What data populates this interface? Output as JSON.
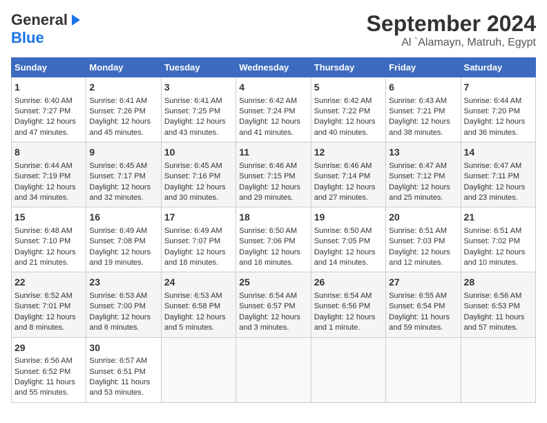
{
  "header": {
    "logo_line1": "General",
    "logo_line2": "Blue",
    "title": "September 2024",
    "subtitle": "Al `Alamayn, Matruh, Egypt"
  },
  "calendar": {
    "days_of_week": [
      "Sunday",
      "Monday",
      "Tuesday",
      "Wednesday",
      "Thursday",
      "Friday",
      "Saturday"
    ],
    "weeks": [
      [
        {
          "day": "",
          "content": ""
        },
        {
          "day": "2",
          "content": "Sunrise: 6:41 AM\nSunset: 7:26 PM\nDaylight: 12 hours\nand 45 minutes."
        },
        {
          "day": "3",
          "content": "Sunrise: 6:41 AM\nSunset: 7:25 PM\nDaylight: 12 hours\nand 43 minutes."
        },
        {
          "day": "4",
          "content": "Sunrise: 6:42 AM\nSunset: 7:24 PM\nDaylight: 12 hours\nand 41 minutes."
        },
        {
          "day": "5",
          "content": "Sunrise: 6:42 AM\nSunset: 7:22 PM\nDaylight: 12 hours\nand 40 minutes."
        },
        {
          "day": "6",
          "content": "Sunrise: 6:43 AM\nSunset: 7:21 PM\nDaylight: 12 hours\nand 38 minutes."
        },
        {
          "day": "7",
          "content": "Sunrise: 6:44 AM\nSunset: 7:20 PM\nDaylight: 12 hours\nand 36 minutes."
        }
      ],
      [
        {
          "day": "1",
          "content": "Sunrise: 6:40 AM\nSunset: 7:27 PM\nDaylight: 12 hours\nand 47 minutes."
        },
        {
          "day": "8",
          "content": ""
        },
        {
          "day": "9",
          "content": ""
        },
        {
          "day": "10",
          "content": ""
        },
        {
          "day": "11",
          "content": ""
        },
        {
          "day": "12",
          "content": ""
        },
        {
          "day": "13",
          "content": ""
        },
        {
          "day": "14",
          "content": ""
        }
      ],
      [
        {
          "day": "8",
          "content": "Sunrise: 6:44 AM\nSunset: 7:19 PM\nDaylight: 12 hours\nand 34 minutes."
        },
        {
          "day": "9",
          "content": "Sunrise: 6:45 AM\nSunset: 7:17 PM\nDaylight: 12 hours\nand 32 minutes."
        },
        {
          "day": "10",
          "content": "Sunrise: 6:45 AM\nSunset: 7:16 PM\nDaylight: 12 hours\nand 30 minutes."
        },
        {
          "day": "11",
          "content": "Sunrise: 6:46 AM\nSunset: 7:15 PM\nDaylight: 12 hours\nand 29 minutes."
        },
        {
          "day": "12",
          "content": "Sunrise: 6:46 AM\nSunset: 7:14 PM\nDaylight: 12 hours\nand 27 minutes."
        },
        {
          "day": "13",
          "content": "Sunrise: 6:47 AM\nSunset: 7:12 PM\nDaylight: 12 hours\nand 25 minutes."
        },
        {
          "day": "14",
          "content": "Sunrise: 6:47 AM\nSunset: 7:11 PM\nDaylight: 12 hours\nand 23 minutes."
        }
      ],
      [
        {
          "day": "15",
          "content": "Sunrise: 6:48 AM\nSunset: 7:10 PM\nDaylight: 12 hours\nand 21 minutes."
        },
        {
          "day": "16",
          "content": "Sunrise: 6:49 AM\nSunset: 7:08 PM\nDaylight: 12 hours\nand 19 minutes."
        },
        {
          "day": "17",
          "content": "Sunrise: 6:49 AM\nSunset: 7:07 PM\nDaylight: 12 hours\nand 18 minutes."
        },
        {
          "day": "18",
          "content": "Sunrise: 6:50 AM\nSunset: 7:06 PM\nDaylight: 12 hours\nand 16 minutes."
        },
        {
          "day": "19",
          "content": "Sunrise: 6:50 AM\nSunset: 7:05 PM\nDaylight: 12 hours\nand 14 minutes."
        },
        {
          "day": "20",
          "content": "Sunrise: 6:51 AM\nSunset: 7:03 PM\nDaylight: 12 hours\nand 12 minutes."
        },
        {
          "day": "21",
          "content": "Sunrise: 6:51 AM\nSunset: 7:02 PM\nDaylight: 12 hours\nand 10 minutes."
        }
      ],
      [
        {
          "day": "22",
          "content": "Sunrise: 6:52 AM\nSunset: 7:01 PM\nDaylight: 12 hours\nand 8 minutes."
        },
        {
          "day": "23",
          "content": "Sunrise: 6:53 AM\nSunset: 7:00 PM\nDaylight: 12 hours\nand 6 minutes."
        },
        {
          "day": "24",
          "content": "Sunrise: 6:53 AM\nSunset: 6:58 PM\nDaylight: 12 hours\nand 5 minutes."
        },
        {
          "day": "25",
          "content": "Sunrise: 6:54 AM\nSunset: 6:57 PM\nDaylight: 12 hours\nand 3 minutes."
        },
        {
          "day": "26",
          "content": "Sunrise: 6:54 AM\nSunset: 6:56 PM\nDaylight: 12 hours\nand 1 minute."
        },
        {
          "day": "27",
          "content": "Sunrise: 6:55 AM\nSunset: 6:54 PM\nDaylight: 11 hours\nand 59 minutes."
        },
        {
          "day": "28",
          "content": "Sunrise: 6:56 AM\nSunset: 6:53 PM\nDaylight: 11 hours\nand 57 minutes."
        }
      ],
      [
        {
          "day": "29",
          "content": "Sunrise: 6:56 AM\nSunset: 6:52 PM\nDaylight: 11 hours\nand 55 minutes."
        },
        {
          "day": "30",
          "content": "Sunrise: 6:57 AM\nSunset: 6:51 PM\nDaylight: 11 hours\nand 53 minutes."
        },
        {
          "day": "",
          "content": ""
        },
        {
          "day": "",
          "content": ""
        },
        {
          "day": "",
          "content": ""
        },
        {
          "day": "",
          "content": ""
        },
        {
          "day": "",
          "content": ""
        }
      ]
    ]
  }
}
